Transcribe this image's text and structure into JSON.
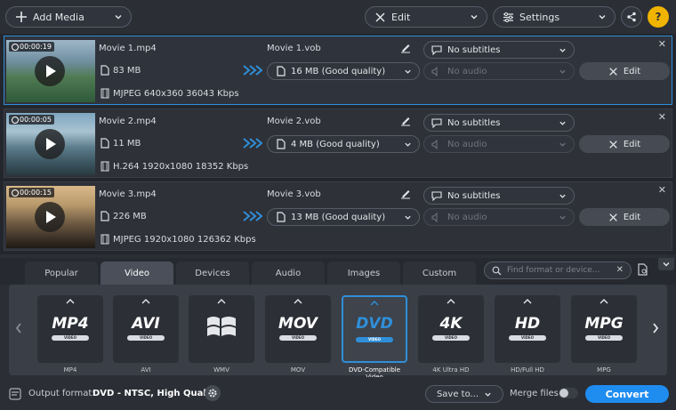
{
  "toolbar": {
    "add_media": "Add Media",
    "edit": "Edit",
    "settings": "Settings"
  },
  "files": [
    {
      "duration": "00:00:19",
      "name": "Movie 1.mp4",
      "size": "83 MB",
      "codec": "MJPEG 640x360 36043 Kbps",
      "output_name": "Movie 1.vob",
      "output_size": "16 MB (Good quality)",
      "subtitles": "No subtitles",
      "audio": "No audio",
      "edit_label": "Edit",
      "selected": true
    },
    {
      "duration": "00:00:05",
      "name": "Movie 2.mp4",
      "size": "11 MB",
      "codec": "H.264 1920x1080 18352 Kbps",
      "output_name": "Movie 2.vob",
      "output_size": "4 MB (Good quality)",
      "subtitles": "No subtitles",
      "audio": "No audio",
      "edit_label": "Edit",
      "selected": false
    },
    {
      "duration": "00:00:15",
      "name": "Movie 3.mp4",
      "size": "226 MB",
      "codec": "MJPEG 1920x1080 126362 Kbps",
      "output_name": "Movie 3.vob",
      "output_size": "13 MB (Good quality)",
      "subtitles": "No subtitles",
      "audio": "No audio",
      "edit_label": "Edit",
      "selected": false
    }
  ],
  "tabs": [
    "Popular",
    "Video",
    "Devices",
    "Audio",
    "Images",
    "Custom"
  ],
  "active_tab": "Video",
  "search": {
    "placeholder": "Find format or device..."
  },
  "formats": [
    {
      "logo": "MP4",
      "sub": "VIDEO",
      "label": "MP4"
    },
    {
      "logo": "AVI",
      "sub": "VIDEO",
      "label": "AVI"
    },
    {
      "logo": "",
      "sub": "",
      "label": "WMV"
    },
    {
      "logo": "MOV",
      "sub": "VIDEO",
      "label": "MOV"
    },
    {
      "logo": "DVD",
      "sub": "VIDEO",
      "label": "DVD-Compatible Video"
    },
    {
      "logo": "4K",
      "sub": "VIDEO",
      "label": "4K Ultra HD"
    },
    {
      "logo": "HD",
      "sub": "VIDEO",
      "label": "HD/Full HD"
    },
    {
      "logo": "MPG",
      "sub": "VIDEO",
      "label": "MPG"
    }
  ],
  "active_format": "DVD-Compatible Video",
  "bottom": {
    "output_format_label": "Output format:",
    "output_format_value": "DVD - NTSC, High Quality",
    "save_to": "Save to...",
    "merge_files": "Merge files:",
    "convert": "Convert"
  },
  "colors": {
    "accent": "#2f8fd9",
    "convert": "#1f8cf0",
    "background": "#2b2e35"
  }
}
